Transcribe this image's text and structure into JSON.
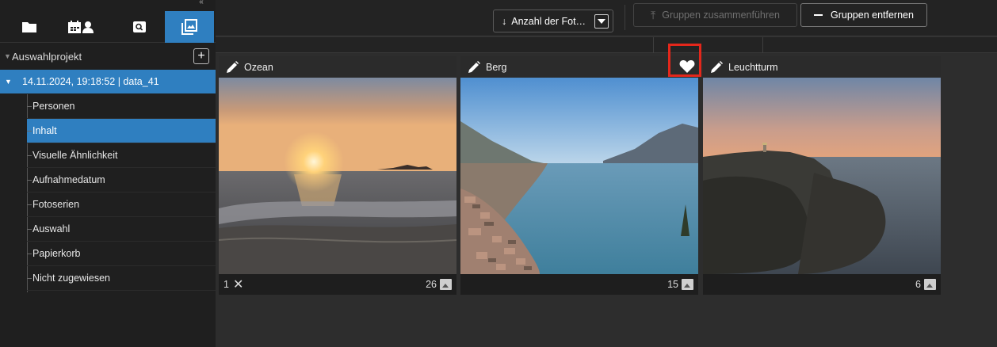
{
  "sidebar": {
    "tabs": [
      {
        "icon": "folder-icon"
      },
      {
        "icon": "calendar-person-icon"
      },
      {
        "icon": "search-box-icon"
      },
      {
        "icon": "photos-icon",
        "active": true
      }
    ],
    "project_label": "Auswahlprojekt",
    "add_label": "+",
    "session_label": "14.11.2024, 19:18:52 | data_41",
    "items": [
      {
        "label": "Personen"
      },
      {
        "label": "Inhalt",
        "active": true
      },
      {
        "label": "Visuelle Ähnlichkeit"
      },
      {
        "label": "Aufnahmedatum"
      },
      {
        "label": "Fotoserien"
      },
      {
        "label": "Auswahl"
      },
      {
        "label": "Papierkorb"
      },
      {
        "label": "Nicht zugewiesen"
      }
    ]
  },
  "toolbar": {
    "sort_arrow": "↓",
    "sort_label": "Anzahl der Fot…",
    "merge_icon": "⤒",
    "merge_label": "Gruppen zusammenführen",
    "remove_label": "Gruppen entfernen"
  },
  "cards": [
    {
      "title": "Ozean",
      "left_count": "1",
      "left_mark": "✕",
      "count": "26",
      "selected": false
    },
    {
      "title": "Berg",
      "left_count": "",
      "left_mark": "",
      "count": "15",
      "selected": true,
      "favorite": true
    },
    {
      "title": "Leuchtturm",
      "left_count": "",
      "left_mark": "",
      "count": "6",
      "selected": false
    }
  ],
  "colors": {
    "accent": "#2f7fc0",
    "selection": "#2fa4e0",
    "highlight": "#e4271b"
  }
}
